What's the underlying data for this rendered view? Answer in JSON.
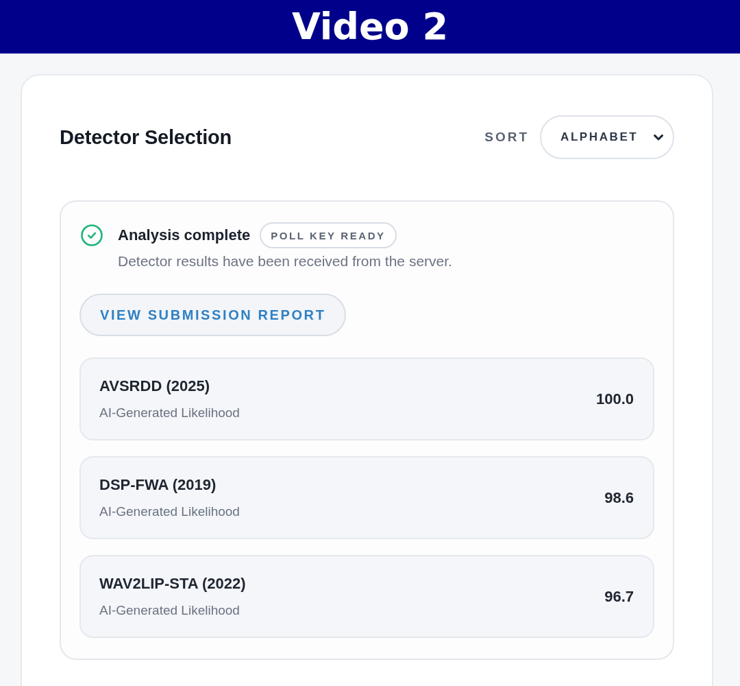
{
  "banner": {
    "title": "Video 2"
  },
  "panel": {
    "title": "Detector Selection",
    "sort": {
      "label": "SORT",
      "value": "ALPHABET"
    }
  },
  "status": {
    "title": "Analysis complete",
    "badge": "POLL KEY READY",
    "message": "Detector results have been received from the server."
  },
  "report_button": {
    "label": "VIEW SUBMISSION REPORT"
  },
  "results": [
    {
      "name": "AVSRDD (2025)",
      "metric": "AI-Generated Likelihood",
      "score": "100.0"
    },
    {
      "name": "DSP-FWA (2019)",
      "metric": "AI-Generated Likelihood",
      "score": "98.6"
    },
    {
      "name": "WAV2LIP-STA (2022)",
      "metric": "AI-Generated Likelihood",
      "score": "96.7"
    }
  ]
}
